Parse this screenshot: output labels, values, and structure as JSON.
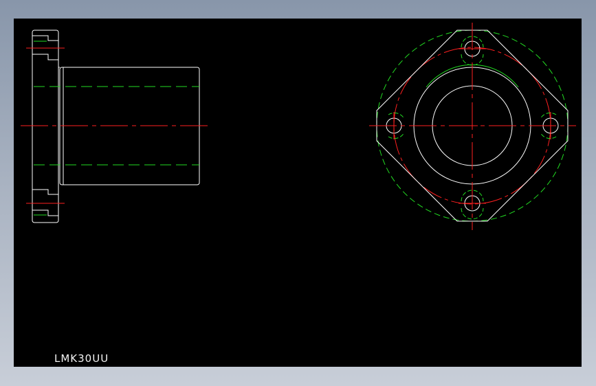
{
  "drawing": {
    "part_label": "LMK30UU",
    "background_color": "#000000",
    "outline_color": "#ffffff",
    "center_line_color": "#ff2020",
    "hidden_line_color": "#22dd22"
  }
}
